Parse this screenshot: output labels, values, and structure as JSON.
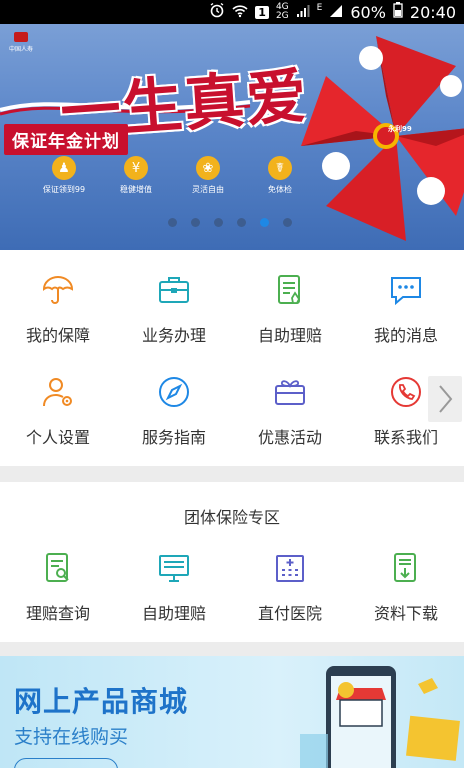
{
  "status_bar": {
    "network_top": "4G",
    "network_bottom": "2G",
    "sim_slot": "1",
    "data_indicator": "E",
    "battery_percent": "60%",
    "time": "20:40",
    "icons": [
      "alarm-icon",
      "wifi-icon",
      "signal-icon",
      "battery-icon"
    ]
  },
  "banner": {
    "headline": "一生真爱",
    "subheadline": "保证年金计划",
    "features": [
      {
        "label": "保证领到99",
        "icon": "person-cane-icon"
      },
      {
        "label": "稳健增值",
        "icon": "coin-icon"
      },
      {
        "label": "灵活自由",
        "icon": "plant-icon"
      },
      {
        "label": "免体检",
        "icon": "stethoscope-icon"
      }
    ],
    "badge": "永利99",
    "carousel_page_count": 6,
    "carousel_active_index": 4
  },
  "quick_menu": [
    {
      "label": "我的保障",
      "icon": "umbrella-icon"
    },
    {
      "label": "业务办理",
      "icon": "briefcase-icon"
    },
    {
      "label": "自助理赔",
      "icon": "claim-doc-icon"
    },
    {
      "label": "我的消息",
      "icon": "chat-icon"
    },
    {
      "label": "个人设置",
      "icon": "user-settings-icon"
    },
    {
      "label": "服务指南",
      "icon": "compass-icon"
    },
    {
      "label": "优惠活动",
      "icon": "gift-card-icon"
    },
    {
      "label": "联系我们",
      "icon": "phone-icon"
    }
  ],
  "group_section": {
    "title": "团体保险专区",
    "items": [
      {
        "label": "理赔查询",
        "icon": "search-doc-icon"
      },
      {
        "label": "自助理赔",
        "icon": "monitor-icon"
      },
      {
        "label": "直付医院",
        "icon": "hospital-icon"
      },
      {
        "label": "资料下载",
        "icon": "download-doc-icon"
      }
    ]
  },
  "mall_banner": {
    "title": "网上产品商城",
    "subtitle": "支持在线购买"
  },
  "colors": {
    "banner_red": "#c8102e",
    "icon_orange": "#f08a24",
    "icon_teal": "#1ea7b8",
    "icon_green": "#4caf50",
    "icon_blue": "#1e88e5",
    "icon_purple": "#5c5fc9",
    "icon_red": "#e53935",
    "mall_blue": "#1e73c9"
  }
}
